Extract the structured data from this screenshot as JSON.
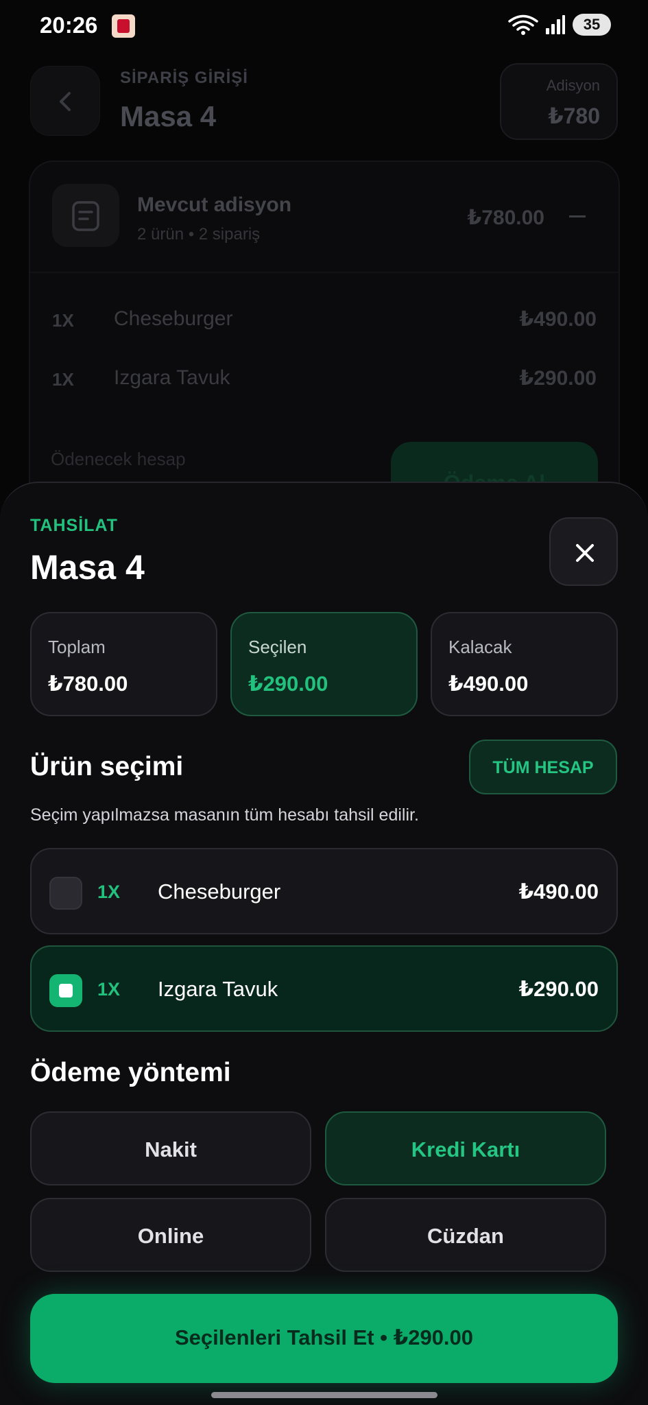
{
  "status_bar": {
    "time": "20:26",
    "battery": "35"
  },
  "background": {
    "eyebrow": "SİPARİŞ GİRİŞİ",
    "title": "Masa 4",
    "adisyon_label": "Adisyon",
    "adisyon_value": "₺780",
    "card": {
      "title": "Mevcut adisyon",
      "subtitle": "2 ürün • 2 sipariş",
      "total": "₺780.00",
      "rows": [
        {
          "qty": "1X",
          "name": "Cheseburger",
          "price": "₺490.00"
        },
        {
          "qty": "1X",
          "name": "Izgara Tavuk",
          "price": "₺290.00"
        }
      ],
      "footer_label": "Ödenecek hesap",
      "footer_button": "Ödeme Al"
    }
  },
  "sheet": {
    "eyebrow": "TAHSİLAT",
    "title": "Masa 4",
    "stats": [
      {
        "label": "Toplam",
        "value": "₺780.00"
      },
      {
        "label": "Seçilen",
        "value": "₺290.00"
      },
      {
        "label": "Kalacak",
        "value": "₺490.00"
      }
    ],
    "product_section": {
      "title": "Ürün seçimi",
      "all_button": "TÜM HESAP",
      "hint": "Seçim yapılmazsa masanın tüm hesabı tahsil edilir."
    },
    "items": [
      {
        "qty": "1X",
        "name": "Cheseburger",
        "price": "₺490.00",
        "selected": false
      },
      {
        "qty": "1X",
        "name": "Izgara Tavuk",
        "price": "₺290.00",
        "selected": true
      }
    ],
    "payment_section": {
      "title": "Ödeme yöntemi",
      "methods": [
        "Nakit",
        "Kredi Kartı",
        "Online",
        "Cüzdan"
      ],
      "selected": "Kredi Kartı"
    },
    "cta": "Seçilenleri Tahsil Et • ₺290.00"
  },
  "colors": {
    "accent": "#22c17e",
    "cta": "#0bab6a",
    "background": "#060607",
    "sheet": "#0d0d10"
  }
}
